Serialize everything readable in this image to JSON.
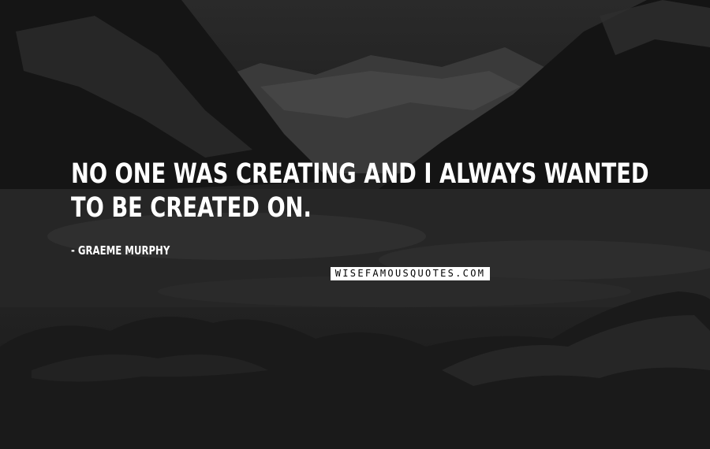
{
  "quote": {
    "text": "NO ONE WAS CREATING AND I ALWAYS WANTED TO BE CREATED ON.",
    "author": "- GRAEME MURPHY"
  },
  "watermark": {
    "text": "WISEFAMOUSQUOTES.COM"
  },
  "colors": {
    "text": "#ffffff",
    "background": "#1e1e1e",
    "watermark_bg": "#ffffff",
    "watermark_text": "#000000"
  }
}
